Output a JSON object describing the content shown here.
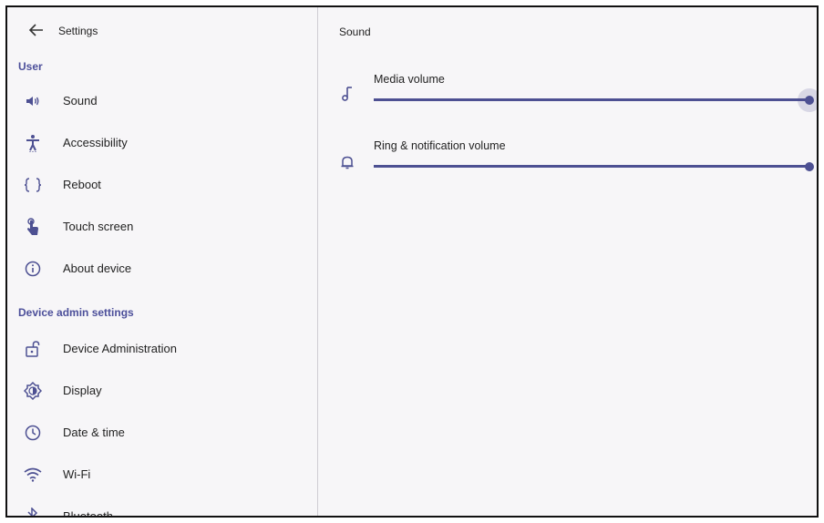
{
  "header": {
    "title": "Settings"
  },
  "sidebar": {
    "sections": [
      {
        "label": "User",
        "items": [
          {
            "label": "Sound",
            "icon": "speaker-icon"
          },
          {
            "label": "Accessibility",
            "icon": "accessibility-icon"
          },
          {
            "label": "Reboot",
            "icon": "braces-icon"
          },
          {
            "label": "Touch screen",
            "icon": "touch-icon"
          },
          {
            "label": "About device",
            "icon": "info-icon"
          }
        ]
      },
      {
        "label": "Device admin settings",
        "items": [
          {
            "label": "Device Administration",
            "icon": "unlock-icon"
          },
          {
            "label": "Display",
            "icon": "brightness-icon"
          },
          {
            "label": "Date & time",
            "icon": "clock-icon"
          },
          {
            "label": "Wi-Fi",
            "icon": "wifi-icon"
          },
          {
            "label": "Bluetooth",
            "icon": "bluetooth-icon"
          }
        ]
      }
    ]
  },
  "main": {
    "title": "Sound",
    "volumes": [
      {
        "label": "Media volume",
        "icon": "music-note-icon",
        "level": 1.0,
        "focused": true
      },
      {
        "label": "Ring & notification volume",
        "icon": "bell-icon",
        "level": 1.0,
        "focused": false
      }
    ]
  },
  "colors": {
    "accent": "#4d5092",
    "section_label": "#4c4f9a",
    "background": "#f7f6f8"
  }
}
